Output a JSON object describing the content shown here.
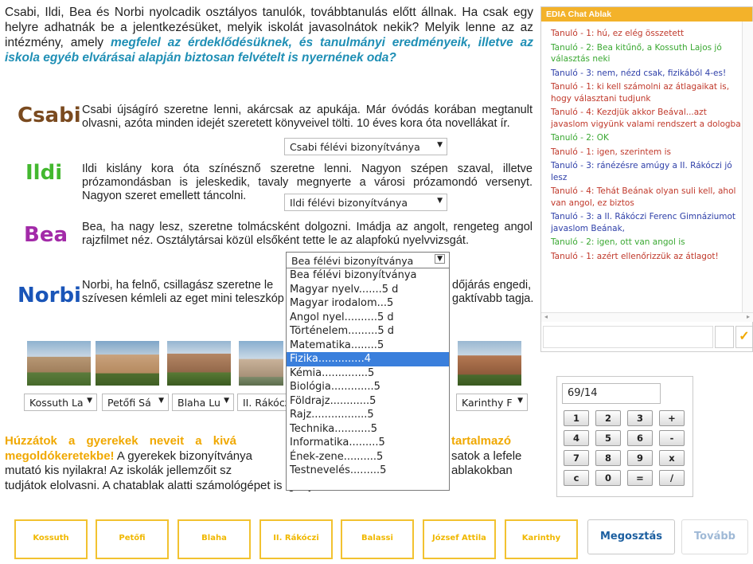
{
  "intro": {
    "text": "Csabi, Ildi, Bea és Norbi nyolcadik osztályos tanulók, továbbtanulás előtt állnak. Ha csak egy helyre adhatnák be a jelentkezésüket, melyik iskolát javasolnátok nekik? Melyik lenne az az intézmény, amely ",
    "highlight": "megfelel az érdeklődésüknek, és tanulmányi eredményeik, illetve az iskola egyéb elvárásai alapján biztosan felvételt is nyernének oda?"
  },
  "kids": [
    {
      "name": "Csabi",
      "color": "#7a4a1f",
      "desc": "Csabi újságíró szeretne lenni, akárcsak az apukája. Már óvódás korában megtanult olvasni, azóta minden idejét szeretett könyveivel tölti. 10 éves kora óta novellákat ír.",
      "select": "Csabi félévi bizonyítványa"
    },
    {
      "name": "Ildi",
      "color": "#43b82f",
      "desc": "Ildi kislány kora óta színésznő szeretne lenni. Nagyon szépen szaval, illetve prózamondásban is jeleskedik, tavaly megnyerte a városi prózamondó versenyt. Nagyon szeret emellett táncolni.",
      "select": "Ildi félévi bizonyítványa"
    },
    {
      "name": "Bea",
      "color": "#a22aa8",
      "desc": "Bea, ha nagy lesz, szeretne tolmácsként dolgozni. Imádja az angolt, rengeteg angol rajzfilmet néz. Osztálytársai közül elsőként tette le az alapfokú nyelvvizsgát.",
      "select": "Bea félévi bizonyítványa"
    },
    {
      "name": "Norbi",
      "color": "#1a55b8",
      "desc_a": "Norbi, ha felnő, csillagász szeretne le",
      "desc_b": "dőjárás engedi,",
      "desc_c": "szívesen kémleli az eget mini teleszkóp",
      "desc_d": "gaktívabb tagja."
    }
  ],
  "dropdown": {
    "options": [
      "Bea félévi bizonyítványa",
      "Magyar nyelv.......5 d",
      "Magyar irodalom...5",
      "Angol nyel..........5 d",
      "Történelem.........5 d",
      "Matematika........5",
      "Fizika..............4",
      "Kémia..............5",
      "Biológia.............5",
      "Földrajz............5",
      "Rajz.................5",
      "Technika...........5",
      "Informatika.........5",
      "Ének-zene..........5",
      "Testnevelés.........5"
    ],
    "selected_index": 6
  },
  "school_selects": [
    "Kossuth La",
    "Petőfi Sá",
    "Blaha Lu",
    "II. Rákócz",
    "Karinthy F"
  ],
  "task": {
    "orange": "Húzzátok a gyerekek neveit a kivá",
    "orange_b": "tartalmazó",
    "orange_c": "megoldókeretekbe!",
    "line1": " A gyerekek bizonyítványa",
    "line1b": "satok a lefele",
    "line2": "mutató kis nyilakra! Az iskolák jellemzőit sz",
    "line2b": "ablakokban",
    "line3": "tudjátok elolvasni. A chatablak alatti számológépet is igénybe vehetitek a munkához!"
  },
  "chat": {
    "title": "EDIA Chat Ablak",
    "messages": [
      {
        "t": "Tanuló - 1: hú, ez elég összetett",
        "c": "#c0392b"
      },
      {
        "t": "Tanuló - 2: Bea kitűnő, a Kossuth Lajos jó választás neki",
        "c": "#3aa832"
      },
      {
        "t": "Tanuló - 3: nem, nézd csak, fizikából 4-es!",
        "c": "#2e3fa8"
      },
      {
        "t": "Tanuló - 1: ki kell számolni az átlagaikat is, hogy választani tudjunk",
        "c": "#c0392b"
      },
      {
        "t": "Tanuló - 4: Kezdjük akkor Beával...azt javaslom vigyünk valami rendszert a dologba",
        "c": "#c0392b"
      },
      {
        "t": "Tanuló - 2: OK",
        "c": "#3aa832"
      },
      {
        "t": "Tanuló - 1: igen, szerintem is",
        "c": "#c0392b"
      },
      {
        "t": "Tanuló - 3: ránézésre amúgy a II. Rákóczi jó lesz",
        "c": "#2e3fa8"
      },
      {
        "t": "Tanuló - 4: Tehát Beának olyan suli kell, ahol van angol, ez biztos",
        "c": "#c0392b"
      },
      {
        "t": "Tanuló - 3: a II. Rákóczi Ferenc Gimnáziumot javaslom Beának,",
        "c": "#2e3fa8"
      },
      {
        "t": "Tanuló - 2: igen, ott van angol is",
        "c": "#3aa832"
      },
      {
        "t": "Tanuló - 1: azért ellenőrizzük az átlagot!",
        "c": "#c0392b"
      }
    ],
    "send_icon": "checkmark-icon"
  },
  "calculator": {
    "display": "69/14",
    "keys": [
      "1",
      "2",
      "3",
      "+",
      "4",
      "5",
      "6",
      "-",
      "7",
      "8",
      "9",
      "x",
      "c",
      "0",
      "=",
      "/"
    ]
  },
  "dropzones": [
    "Kossuth",
    "Petőfi",
    "Blaha",
    "II. Rákóczi",
    "Balassi",
    "József Attila",
    "Karinthy"
  ],
  "buttons": {
    "share": "Megosztás",
    "next": "Tovább"
  }
}
